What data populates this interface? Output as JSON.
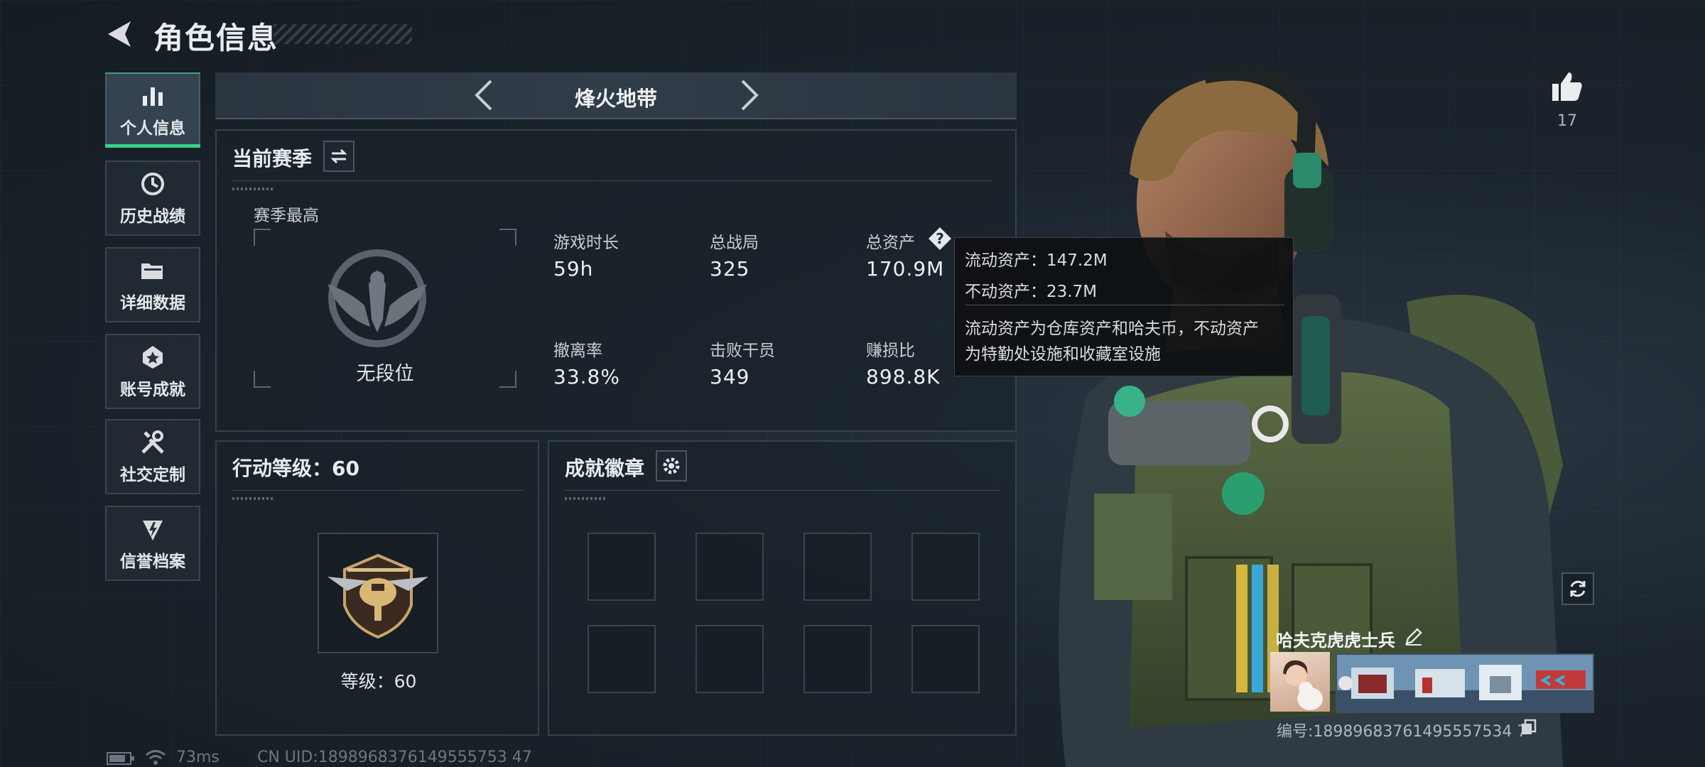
{
  "header": {
    "title": "角色信息"
  },
  "sidebar": {
    "items": [
      {
        "label": "个人信息",
        "icon": "bar-chart-icon",
        "active": true
      },
      {
        "label": "历史战绩",
        "icon": "history-clock-icon",
        "active": false
      },
      {
        "label": "详细数据",
        "icon": "folder-icon",
        "active": false
      },
      {
        "label": "账号成就",
        "icon": "achievement-icon",
        "active": false
      },
      {
        "label": "社交定制",
        "icon": "tools-icon",
        "active": false
      },
      {
        "label": "信誉档案",
        "icon": "shield-lightning-icon",
        "active": false
      }
    ]
  },
  "mode": {
    "title": "烽火地带"
  },
  "season": {
    "title": "当前赛季",
    "best_label": "赛季最高",
    "rank": "无段位",
    "stats": [
      {
        "label": "游戏时长",
        "value": "59h"
      },
      {
        "label": "总战局",
        "value": "325"
      },
      {
        "label": "总资产",
        "value": "170.9M"
      },
      {
        "label": "撤离率",
        "value": "33.8%"
      },
      {
        "label": "击败干员",
        "value": "349"
      },
      {
        "label": "赚损比",
        "value": "898.8K"
      }
    ]
  },
  "tooltip": {
    "liquid": "流动资产：147.2M",
    "fixed": "不动资产：23.7M",
    "desc1": "流动资产为仓库资产和哈夫币，不动资产",
    "desc2": "为特勤处设施和收藏室设施"
  },
  "level": {
    "title": "行动等级：60",
    "label": "等级：60"
  },
  "badges": {
    "title": "成就徽章"
  },
  "status_bar": {
    "ping": "73ms",
    "uid": "CN UID:1898968376149555753 47"
  },
  "profile": {
    "likes": "17",
    "name": "哈夫克虎虎士兵",
    "id": "编号:18989683761495557534 7"
  },
  "colors": {
    "accent": "#35d08a",
    "panel_border": "#36414b",
    "text": "#e8ecef"
  }
}
